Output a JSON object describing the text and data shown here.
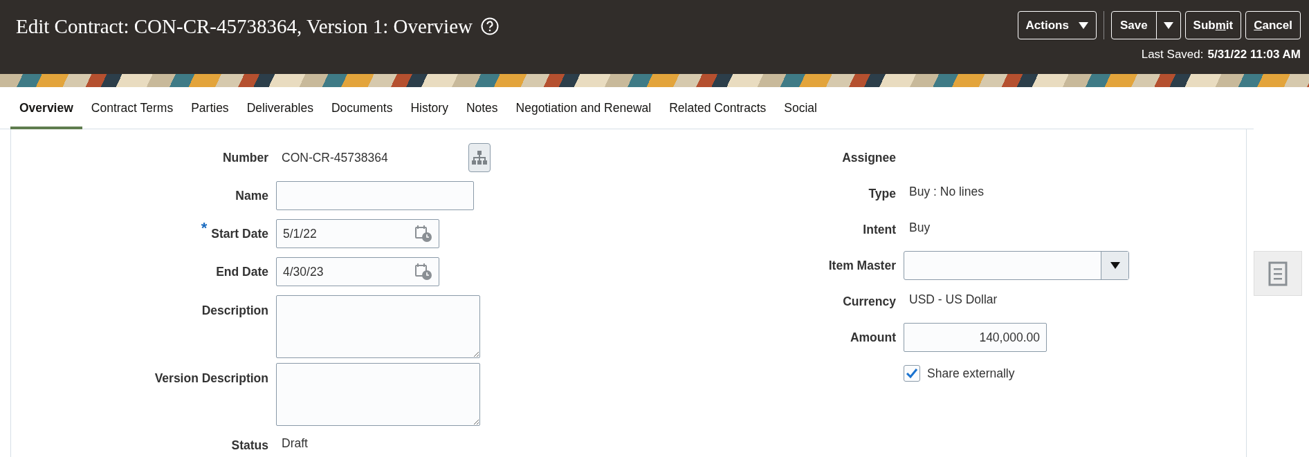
{
  "header": {
    "title": "Edit Contract: CON-CR-45738364, Version 1: Overview",
    "buttons": [
      {
        "kind": "menu",
        "label": "Actions"
      },
      {
        "kind": "split",
        "label": "Save"
      },
      {
        "kind": "plain",
        "before": "Sub",
        "key": "m",
        "after": "it"
      },
      {
        "kind": "plain",
        "key": "C",
        "after": "ancel"
      }
    ],
    "last_saved": {
      "label": "Last Saved:",
      "value": "5/31/22 11:03 AM"
    }
  },
  "tabs": [
    {
      "label": "Overview",
      "selected": true
    },
    {
      "label": "Contract Terms",
      "selected": false
    },
    {
      "label": "Parties",
      "selected": false
    },
    {
      "label": "Deliverables",
      "selected": false
    },
    {
      "label": "Documents",
      "selected": false
    },
    {
      "label": "History",
      "selected": false
    },
    {
      "label": "Notes",
      "selected": false
    },
    {
      "label": "Negotiation and Renewal",
      "selected": false
    },
    {
      "label": "Related Contracts",
      "selected": false
    },
    {
      "label": "Social",
      "selected": false
    }
  ],
  "left_fields": [
    {
      "kind": "number",
      "label": "Number",
      "value": "CON-CR-45738364"
    },
    {
      "kind": "input",
      "label": "Name"
    },
    {
      "kind": "date",
      "label": "Start Date",
      "value": "5/1/22",
      "required_mark": "*"
    },
    {
      "kind": "date",
      "label": "End Date",
      "value": "4/30/23"
    },
    {
      "kind": "textarea",
      "label": "Description"
    },
    {
      "kind": "textarea",
      "label": "Version Description"
    },
    {
      "kind": "value",
      "label": "Status",
      "value": "Draft"
    }
  ],
  "right_fields": [
    {
      "kind": "label",
      "label": "Assignee"
    },
    {
      "kind": "value",
      "label": "Type",
      "value": "Buy : No lines"
    },
    {
      "kind": "value",
      "label": "Intent",
      "value": "Buy"
    },
    {
      "kind": "select",
      "label": "Item Master"
    },
    {
      "kind": "value",
      "label": "Currency",
      "value": "USD - US Dollar"
    },
    {
      "kind": "amount",
      "label": "Amount",
      "value": "140,000.00"
    },
    {
      "kind": "checkbox",
      "label": "Share externally",
      "checked": true
    }
  ]
}
